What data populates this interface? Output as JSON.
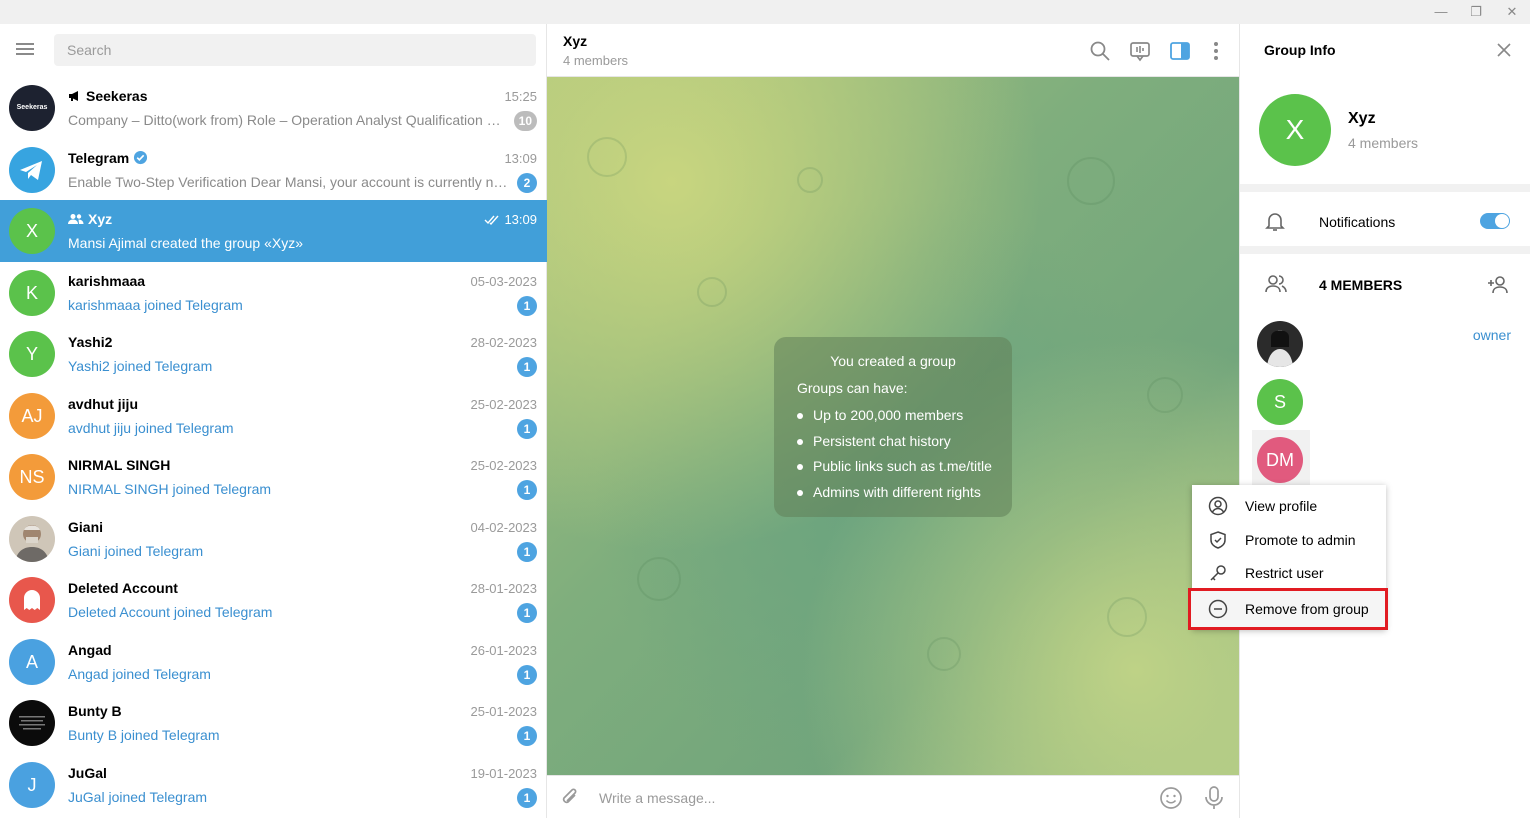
{
  "window": {
    "minimize_glyph": "—",
    "restore_glyph": "❐",
    "close_glyph": "✕"
  },
  "sidebar": {
    "menu_icon": "hamburger-icon",
    "search_placeholder": "Search",
    "chats": [
      {
        "name": "Seekeras",
        "kind": "channel",
        "time": "15:25",
        "message": "Company – Ditto(work from) Role – Operation Analyst Qualification – An...",
        "badge": "10",
        "badge_muted": true,
        "avatar_text": "Seekeras",
        "avatar_color": "#1d2230",
        "message_style": "normal"
      },
      {
        "name": "Telegram",
        "kind": "verified",
        "time": "13:09",
        "message": "Enable Two-Step Verification Dear Mansi, your account is currently not p...",
        "badge": "2",
        "badge_muted": false,
        "avatar_text": "",
        "avatar_color": "#37a4e0",
        "message_style": "normal"
      },
      {
        "name": "Xyz",
        "kind": "group",
        "time": "13:09",
        "message": "Mansi Ajimal created the group «Xyz»",
        "badge": "",
        "avatar_text": "X",
        "avatar_color": "#5bc24b",
        "active": true,
        "message_style": "normal"
      },
      {
        "name": "karishmaaa",
        "time": "05-03-2023",
        "message": "karishmaaa joined Telegram",
        "badge": "1",
        "avatar_text": "K",
        "avatar_color": "#5bc24b",
        "message_style": "joined"
      },
      {
        "name": "Yashi2",
        "time": "28-02-2023",
        "message": "Yashi2 joined Telegram",
        "badge": "1",
        "avatar_text": "Y",
        "avatar_color": "#5bc24b",
        "message_style": "joined"
      },
      {
        "name": "avdhut jiju",
        "time": "25-02-2023",
        "message": "avdhut jiju joined Telegram",
        "badge": "1",
        "avatar_text": "AJ",
        "avatar_color": "#f39b3a",
        "message_style": "joined"
      },
      {
        "name": "NIRMAL SINGH",
        "time": "25-02-2023",
        "message": "NIRMAL SINGH joined Telegram",
        "badge": "1",
        "avatar_text": "NS",
        "avatar_color": "#f39b3a",
        "message_style": "joined"
      },
      {
        "name": "Giani",
        "time": "04-02-2023",
        "message": "Giani joined Telegram",
        "badge": "1",
        "avatar_text": "",
        "avatar_color": "#9a8b78",
        "message_style": "joined"
      },
      {
        "name": "Deleted Account",
        "time": "28-01-2023",
        "message": "Deleted Account joined Telegram",
        "badge": "1",
        "avatar_text": "",
        "avatar_color": "#e8574c",
        "message_style": "joined"
      },
      {
        "name": "Angad",
        "time": "26-01-2023",
        "message": "Angad joined Telegram",
        "badge": "1",
        "avatar_text": "A",
        "avatar_color": "#4aa1e0",
        "message_style": "joined"
      },
      {
        "name": "Bunty B",
        "time": "25-01-2023",
        "message": "Bunty B joined Telegram",
        "badge": "1",
        "avatar_text": "",
        "avatar_color": "#0b0b0b",
        "message_style": "joined"
      },
      {
        "name": "JuGal",
        "time": "19-01-2023",
        "message": "JuGal joined Telegram",
        "badge": "1",
        "avatar_text": "J",
        "avatar_color": "#4aa1e0",
        "message_style": "joined"
      }
    ]
  },
  "chat": {
    "title": "Xyz",
    "subtitle": "4 members",
    "service": {
      "title": "You created a group",
      "subtitle": "Groups can have:",
      "items": [
        "Up to 200,000 members",
        "Persistent chat history",
        "Public links such as t.me/title",
        "Admins with different rights"
      ]
    },
    "composer_placeholder": "Write a message..."
  },
  "group_info": {
    "title": "Group Info",
    "avatar_text": "X",
    "name": "Xyz",
    "members_text": "4 members",
    "notifications_label": "Notifications",
    "notifications_on": true,
    "members_header": "4 MEMBERS",
    "members": [
      {
        "avatar_text": "",
        "avatar_color": "#2b2b2b",
        "role": "owner"
      },
      {
        "avatar_text": "S",
        "avatar_color": "#5bc24b",
        "role": ""
      },
      {
        "avatar_text": "DM",
        "avatar_color": "#e15a7e",
        "role": ""
      }
    ]
  },
  "context_menu": {
    "items": [
      {
        "label": "View profile",
        "icon": "user-circle-icon"
      },
      {
        "label": "Promote to admin",
        "icon": "shield-icon"
      },
      {
        "label": "Restrict user",
        "icon": "key-icon"
      },
      {
        "label": "Remove from group",
        "icon": "minus-circle-icon",
        "highlighted": true
      }
    ]
  },
  "colors": {
    "accent": "#419fd9",
    "link": "#3a8fd0",
    "highlight_box": "#e11b22"
  }
}
